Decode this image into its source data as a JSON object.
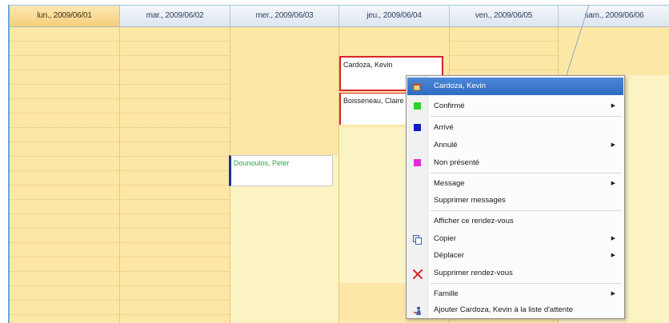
{
  "colors": {
    "confirme": "#2bd12b",
    "arrive": "#0b1fbf",
    "non_presente": "#e02ad8",
    "cancel_x": "#d8262c",
    "appointment_border": "#d8262c",
    "menu_highlight": "#3a76cf"
  },
  "calendar": {
    "days": [
      {
        "label": "lun., 2009/06/01",
        "selected": true
      },
      {
        "label": "mar., 2009/06/02",
        "selected": false
      },
      {
        "label": "mer., 2009/06/03",
        "selected": false
      },
      {
        "label": "jeu., 2009/06/04",
        "selected": false
      },
      {
        "label": "ven., 2009/06/05",
        "selected": false
      },
      {
        "label": "sam., 2009/06/06",
        "selected": false
      }
    ],
    "appointments": {
      "cardoza": "Cardoza, Kevin",
      "boisseneau": "Boisseneau, Claire",
      "dounoulos": "Dounoulos, Peter"
    }
  },
  "context_menu": {
    "title": {
      "label": "Cardoza, Kevin",
      "icon": "calendar-person-icon"
    },
    "items": [
      {
        "label": "Confirmé",
        "icon": "green-square-icon",
        "submenu": true
      },
      {
        "label": "Arrivé",
        "icon": "blue-square-icon",
        "submenu": false
      },
      {
        "label": "Annulé",
        "icon": "",
        "submenu": true
      },
      {
        "label": "Non présenté",
        "icon": "magenta-square-icon",
        "submenu": false
      },
      {
        "label": "Message",
        "icon": "",
        "submenu": true
      },
      {
        "label": "Supprimer messages",
        "icon": "",
        "submenu": false
      },
      {
        "label": "Afficher ce rendez-vous",
        "icon": "",
        "submenu": false
      },
      {
        "label": "Copier",
        "icon": "copy-icon",
        "submenu": true
      },
      {
        "label": "Déplacer",
        "icon": "",
        "submenu": true
      },
      {
        "label": "Supprimer rendez-vous",
        "icon": "delete-x-icon",
        "submenu": false
      },
      {
        "label": "Famille",
        "icon": "",
        "submenu": true
      },
      {
        "label": "Ajouter Cardoza, Kevin à la liste d'attente",
        "icon": "waitlist-person-icon",
        "submenu": false
      }
    ]
  }
}
